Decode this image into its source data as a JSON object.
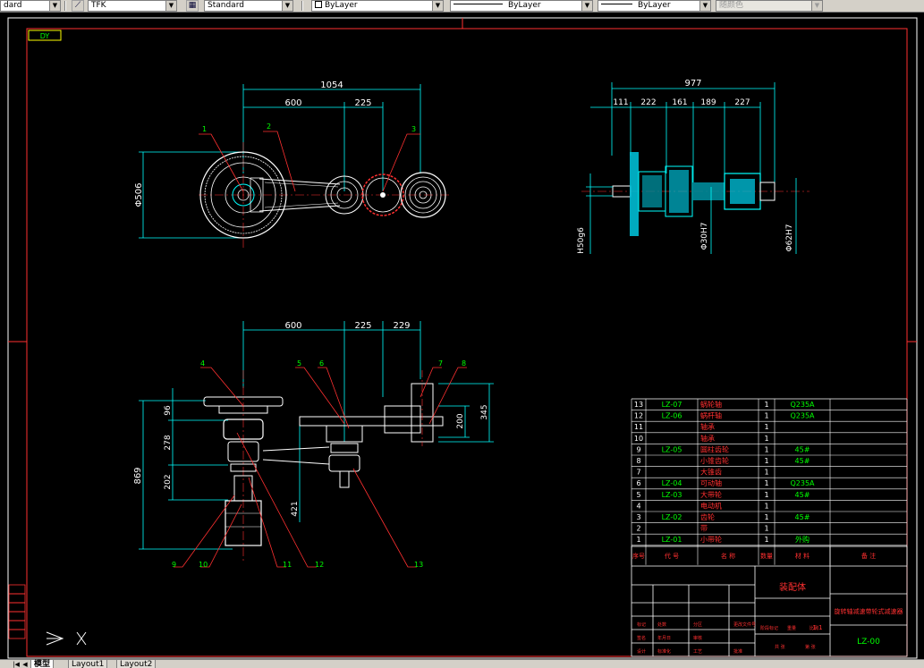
{
  "toolbar": {
    "text_style": "dard",
    "dim_style": "TFK",
    "table_style": "Standard",
    "layer": "ByLayer",
    "linetype": "ByLayer",
    "lineweight": "ByLayer",
    "color": "随颜色"
  },
  "view_label": "DY",
  "top_dims": {
    "overall": "1054",
    "d600": "600",
    "d225": "225",
    "dia506": "Φ506",
    "balloon1": "1",
    "balloon2": "2",
    "balloon3": "3"
  },
  "side_dims": {
    "overall": "977",
    "d111": "111",
    "d222": "222",
    "d161": "161",
    "d189": "189",
    "d227": "227",
    "fit_h50": "H50g6",
    "fit_30": "Φ30H7",
    "fit_62": "Φ62H7"
  },
  "front_dims": {
    "d600": "600",
    "d225": "225",
    "d229": "229",
    "d96": "96",
    "d278": "278",
    "d202": "202",
    "d869": "869",
    "d421": "421",
    "d200": "200",
    "d345": "345",
    "b4": "4",
    "b5": "5",
    "b6": "6",
    "b7": "7",
    "b8": "8",
    "b9": "9",
    "b10": "10",
    "b11": "11",
    "b12": "12",
    "b13": "13"
  },
  "bom": {
    "rows": [
      {
        "no": "13",
        "code": "LZ-07",
        "name": "蜗轮轴",
        "qty": "1",
        "mat": "Q235A"
      },
      {
        "no": "12",
        "code": "LZ-06",
        "name": "蜗杆轴",
        "qty": "1",
        "mat": "Q235A"
      },
      {
        "no": "11",
        "code": "",
        "name": "轴承",
        "qty": "1",
        "mat": ""
      },
      {
        "no": "10",
        "code": "",
        "name": "轴承",
        "qty": "1",
        "mat": ""
      },
      {
        "no": "9",
        "code": "LZ-05",
        "name": "圆柱齿轮",
        "qty": "1",
        "mat": "45#"
      },
      {
        "no": "8",
        "code": "",
        "name": "小锥齿轮",
        "qty": "1",
        "mat": "45#"
      },
      {
        "no": "7",
        "code": "",
        "name": "大锥齿",
        "qty": "1",
        "mat": ""
      },
      {
        "no": "6",
        "code": "LZ-04",
        "name": "可动轴",
        "qty": "1",
        "mat": "Q235A"
      },
      {
        "no": "5",
        "code": "LZ-03",
        "name": "大带轮",
        "qty": "1",
        "mat": "45#"
      },
      {
        "no": "4",
        "code": "",
        "name": "电动机",
        "qty": "1",
        "mat": ""
      },
      {
        "no": "3",
        "code": "LZ-02",
        "name": "齿轮",
        "qty": "1",
        "mat": "45#"
      },
      {
        "no": "2",
        "code": "",
        "name": "带",
        "qty": "1",
        "mat": ""
      },
      {
        "no": "1",
        "code": "LZ-01",
        "name": "小带轮",
        "qty": "1",
        "mat": "外购"
      }
    ],
    "header": {
      "no": "序号",
      "code": "代 号",
      "name": "名 称",
      "qty": "数量",
      "mat": "材 料",
      "note": "备 注"
    }
  },
  "title_block": {
    "drawing_title": "装配体",
    "description": "旋转轴减速带轮式减速器",
    "drawing_no": "LZ-00",
    "scale": "1:1",
    "labels": [
      "标记",
      "处数",
      "分区",
      "更改文件号",
      "签名",
      "年月日",
      "设计",
      "标准化",
      "阶段标记",
      "重量",
      "比例",
      "审核",
      "工艺",
      "批准",
      "共 张",
      "第 张"
    ]
  },
  "tabs": {
    "model": "模型",
    "layout1": "Layout1",
    "layout2": "Layout2"
  }
}
